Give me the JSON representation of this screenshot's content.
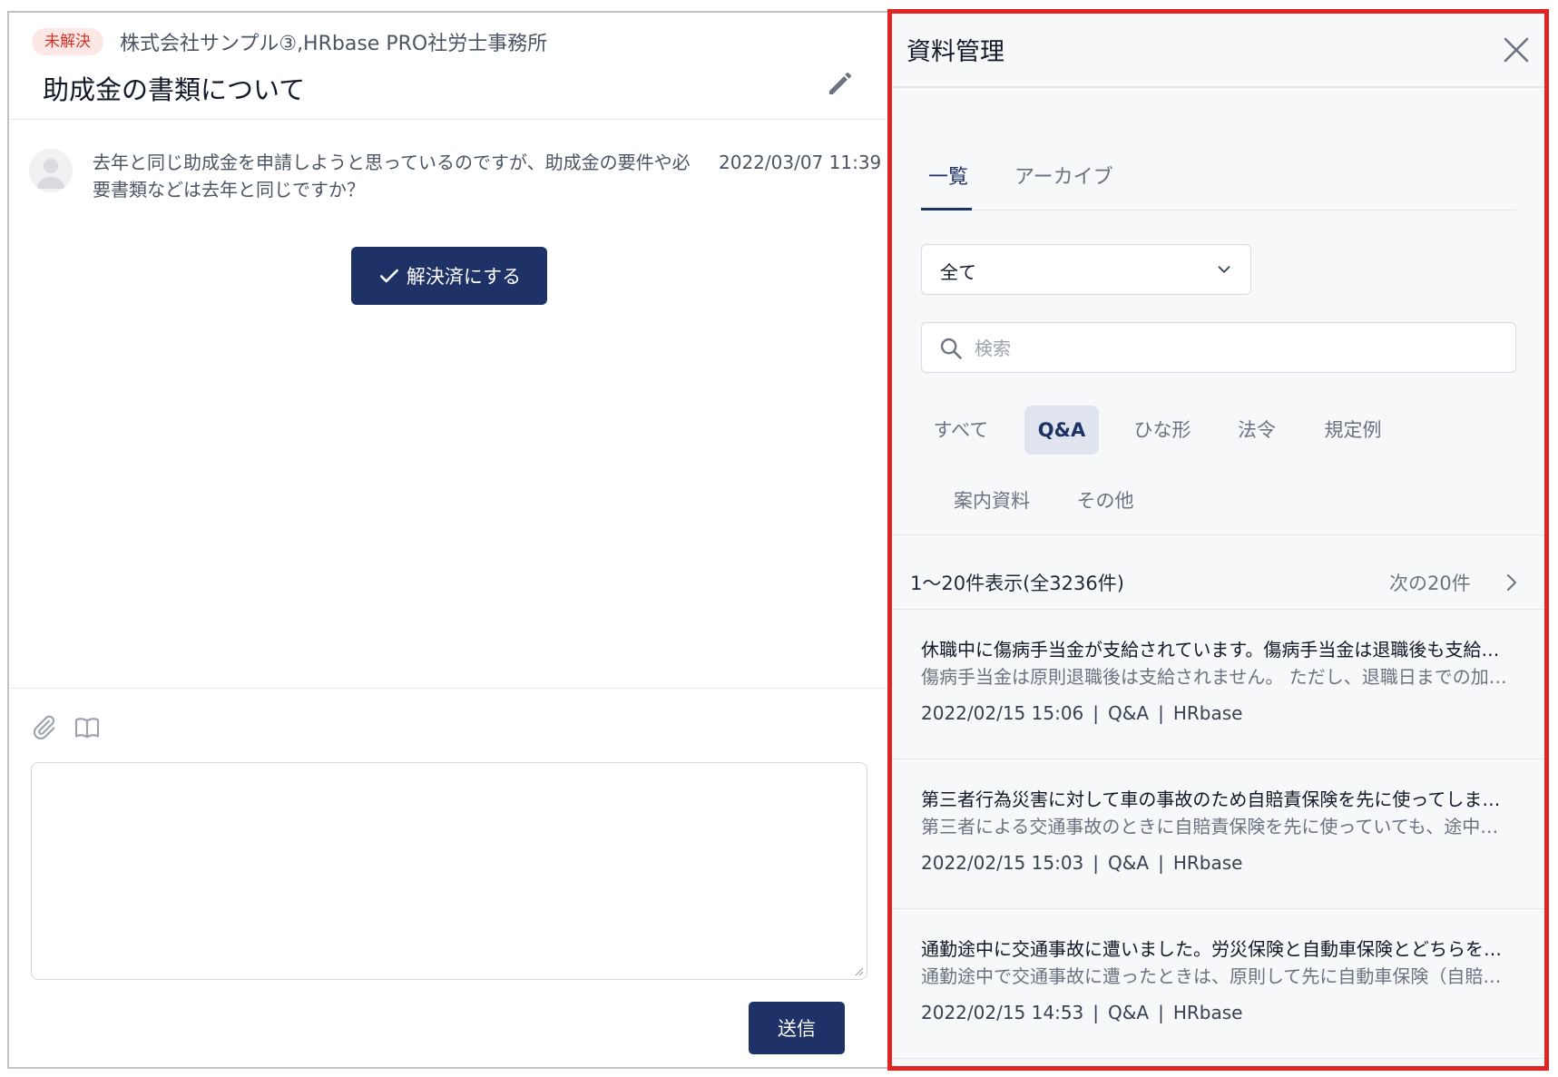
{
  "thread": {
    "status_badge": "未解決",
    "company": "株式会社サンプル③,HRbase PRO社労士事務所",
    "title": "助成金の書類について",
    "message": {
      "text": "去年と同じ助成金を申請しようと思っているのですが、助成金の要件や必要書類などは去年と同じですか？",
      "time": "2022/03/07 11:39"
    },
    "resolve_label": "解決済にする",
    "send_label": "送信",
    "reply_value": ""
  },
  "icons": {
    "edit": "pencil-icon",
    "attach": "paperclip-icon",
    "library": "book-icon",
    "close": "close-icon",
    "dropdown": "chevron-down-icon",
    "search": "search-icon",
    "next": "chevron-right-icon",
    "check": "check-icon"
  },
  "colors": {
    "primary": "#1e3268",
    "badge_bg": "#fde7e5",
    "badge_text": "#d2342a",
    "highlight_border": "#e02323",
    "chip_active_bg": "#dfe4ef"
  },
  "panel": {
    "title": "資料管理",
    "tabs": [
      {
        "label": "一覧",
        "active": true
      },
      {
        "label": "アーカイブ",
        "active": false
      }
    ],
    "filter_select": {
      "value": "全て"
    },
    "search": {
      "placeholder": "検索",
      "value": ""
    },
    "categories": [
      {
        "label": "すべて",
        "active": false
      },
      {
        "label": "Q&A",
        "active": true
      },
      {
        "label": "ひな形",
        "active": false
      },
      {
        "label": "法令",
        "active": false
      },
      {
        "label": "規定例",
        "active": false
      },
      {
        "label": "案内資料",
        "active": false
      },
      {
        "label": "その他",
        "active": false
      }
    ],
    "count_text": "1～20件表示(全3236件)",
    "next_label": "次の20件",
    "items": [
      {
        "title": "休職中に傷病手当金が支給されています。傷病手当金は退職後も支給されますか？",
        "snippet": "傷病手当金は原則退職後は支給されません。 ただし、退職日までの加入期間などの要件を満たす場合は継続して受給できます。",
        "date": "2022/02/15 15:06",
        "category": "Q&A",
        "source": "HRbase"
      },
      {
        "title": "第三者行為災害に対して車の事故のため自賠責保険を先に使ってしまいました",
        "snippet": "第三者による交通事故のときに自賠責保険を先に使っていても、途中から労災保険に切り替えることができます。",
        "date": "2022/02/15 15:03",
        "category": "Q&A",
        "source": "HRbase"
      },
      {
        "title": "通勤途中に交通事故に遭いました。労災保険と自動車保険とどちらを使うべきですか？",
        "snippet": "通勤途中で交通事故に遭ったときは、原則して先に自動車保険（自賠責保険）を使います。",
        "date": "2022/02/15 14:53",
        "category": "Q&A",
        "source": "HRbase"
      }
    ]
  }
}
